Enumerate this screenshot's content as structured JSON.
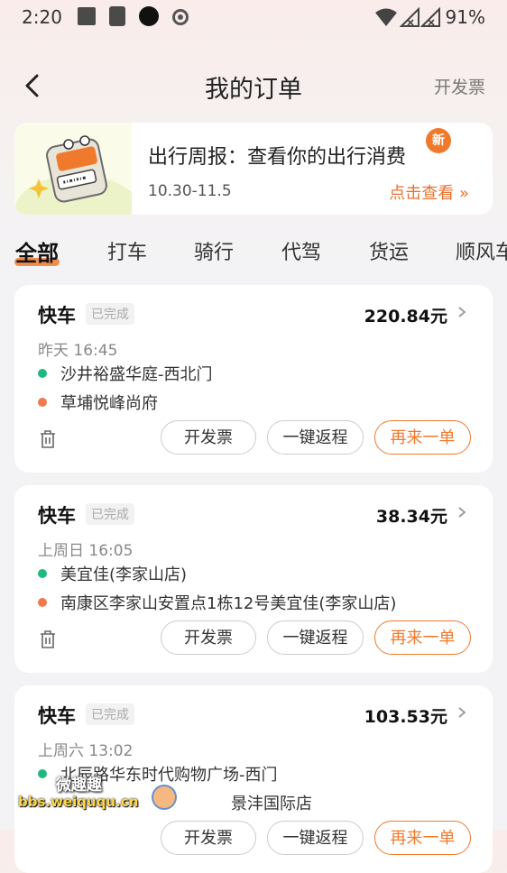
{
  "status": {
    "time": "2:20",
    "battery": "91%"
  },
  "header": {
    "title": "我的订单",
    "right_action": "开发票"
  },
  "promo": {
    "title": "出行周报：查看你的出行消费",
    "badge": "新",
    "date_range": "10.30-11.5",
    "link_label": "点击查看 »"
  },
  "tabs": [
    "全部",
    "打车",
    "骑行",
    "代驾",
    "货运",
    "顺风车"
  ],
  "orders": [
    {
      "type": "快车",
      "status": "已完成",
      "price": "220.84元",
      "time": "昨天 16:45",
      "from": "沙井裕盛华庭-西北门",
      "to": "草埔悦峰尚府",
      "actions": [
        "开发票",
        "一键返程",
        "再来一单"
      ]
    },
    {
      "type": "快车",
      "status": "已完成",
      "price": "38.34元",
      "time": "上周日 16:05",
      "from": "美宜佳(李家山店)",
      "to": "南康区李家山安置点1栋12号美宜佳(李家山店)",
      "actions": [
        "开发票",
        "一键返程",
        "再来一单"
      ]
    },
    {
      "type": "快车",
      "status": "已完成",
      "price": "103.53元",
      "time": "上周六 13:02",
      "from": "北辰路华东时代购物广场-西门",
      "to": "景沣国际店",
      "actions": [
        "开发票",
        "一键返程",
        "再来一单"
      ]
    }
  ],
  "watermark": {
    "line1": "微趣趣",
    "line2": "bbs.weiququ.cn"
  },
  "colors": {
    "accent": "#f07a2c",
    "start_dot": "#1fb97f",
    "end_dot": "#f07a4a"
  }
}
